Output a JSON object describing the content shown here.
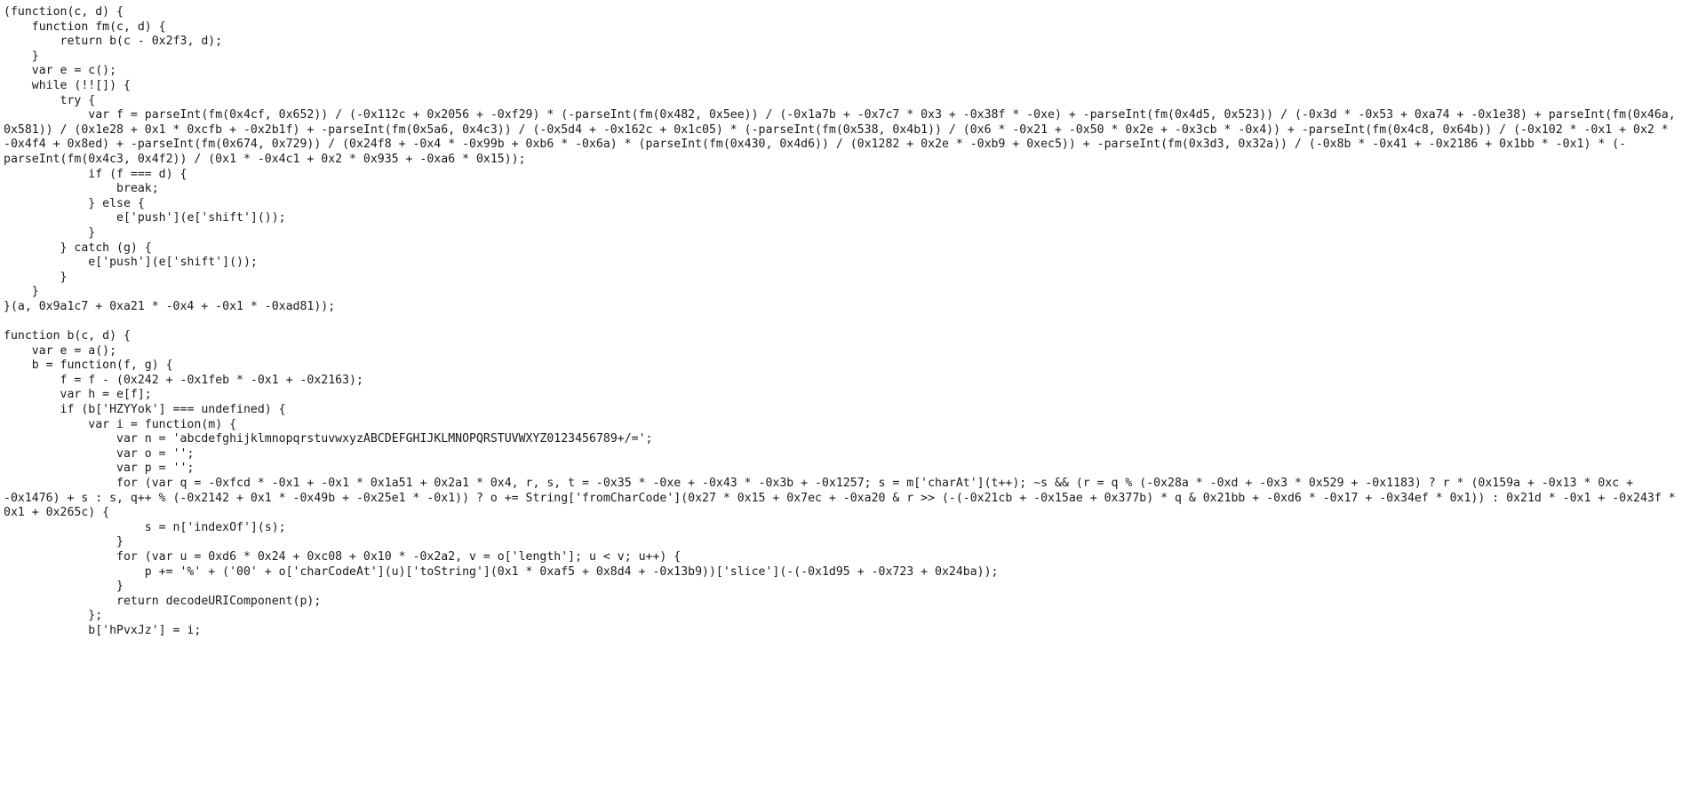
{
  "viewer": {
    "kind": "plain-text-code-view",
    "language": "javascript",
    "background_color": "#ffffff",
    "text_color": "#1a1a1a",
    "font_size_px": 13,
    "line_height_px": 16.6,
    "wrap": "soft-wrap-enabled"
  },
  "code": {
    "text": "(function(c, d) {\n    function fm(c, d) {\n        return b(c - 0x2f3, d);\n    }\n    var e = c();\n    while (!![]) {\n        try {\n            var f = parseInt(fm(0x4cf, 0x652)) / (-0x112c + 0x2056 + -0xf29) * (-parseInt(fm(0x482, 0x5ee)) / (-0x1a7b + -0x7c7 * 0x3 + -0x38f * -0xe) + -parseInt(fm(0x4d5, 0x523)) / (-0x3d * -0x53 + 0xa74 + -0x1e38) + parseInt(fm(0x46a, 0x581)) / (0x1e28 + 0x1 * 0xcfb + -0x2b1f) + -parseInt(fm(0x5a6, 0x4c3)) / (-0x5d4 + -0x162c + 0x1c05) * (-parseInt(fm(0x538, 0x4b1)) / (0x6 * -0x21 + -0x50 * 0x2e + -0x3cb * -0x4)) + -parseInt(fm(0x4c8, 0x64b)) / (-0x102 * -0x1 + 0x2 * -0x4f4 + 0x8ed) + -parseInt(fm(0x674, 0x729)) / (0x24f8 + -0x4 * -0x99b + 0xb6 * -0x6a) * (parseInt(fm(0x430, 0x4d6)) / (0x1282 + 0x2e * -0xb9 + 0xec5)) + -parseInt(fm(0x3d3, 0x32a)) / (-0x8b * -0x41 + -0x2186 + 0x1bb * -0x1) * (-parseInt(fm(0x4c3, 0x4f2)) / (0x1 * -0x4c1 + 0x2 * 0x935 + -0xa6 * 0x15));\n            if (f === d) {\n                break;\n            } else {\n                e['push'](e['shift']());\n            }\n        } catch (g) {\n            e['push'](e['shift']());\n        }\n    }\n}(a, 0x9a1c7 + 0xa21 * -0x4 + -0x1 * -0xad81));\n\nfunction b(c, d) {\n    var e = a();\n    b = function(f, g) {\n        f = f - (0x242 + -0x1feb * -0x1 + -0x2163);\n        var h = e[f];\n        if (b['HZYYok'] === undefined) {\n            var i = function(m) {\n                var n = 'abcdefghijklmnopqrstuvwxyzABCDEFGHIJKLMNOPQRSTUVWXYZ0123456789+/=';\n                var o = '';\n                var p = '';\n                for (var q = -0xfcd * -0x1 + -0x1 * 0x1a51 + 0x2a1 * 0x4, r, s, t = -0x35 * -0xe + -0x43 * -0x3b + -0x1257; s = m['charAt'](t++); ~s && (r = q % (-0x28a * -0xd + -0x3 * 0x529 + -0x1183) ? r * (0x159a + -0x13 * 0xc + -0x1476) + s : s, q++ % (-0x2142 + 0x1 * -0x49b + -0x25e1 * -0x1)) ? o += String['fromCharCode'](0x27 * 0x15 + 0x7ec + -0xa20 & r >> (-(-0x21cb + -0x15ae + 0x377b) * q & 0x21bb + -0xd6 * -0x17 + -0x34ef * 0x1)) : 0x21d * -0x1 + -0x243f * 0x1 + 0x265c) {\n                    s = n['indexOf'](s);\n                }\n                for (var u = 0xd6 * 0x24 + 0xc08 + 0x10 * -0x2a2, v = o['length']; u < v; u++) {\n                    p += '%' + ('00' + o['charCodeAt'](u)['toString'](0x1 * 0xaf5 + 0x8d4 + -0x13b9))['slice'](-(-0x1d95 + -0x723 + 0x24ba));\n                }\n                return decodeURIComponent(p);\n            };\n            b['hPvxJz'] = i;"
  }
}
